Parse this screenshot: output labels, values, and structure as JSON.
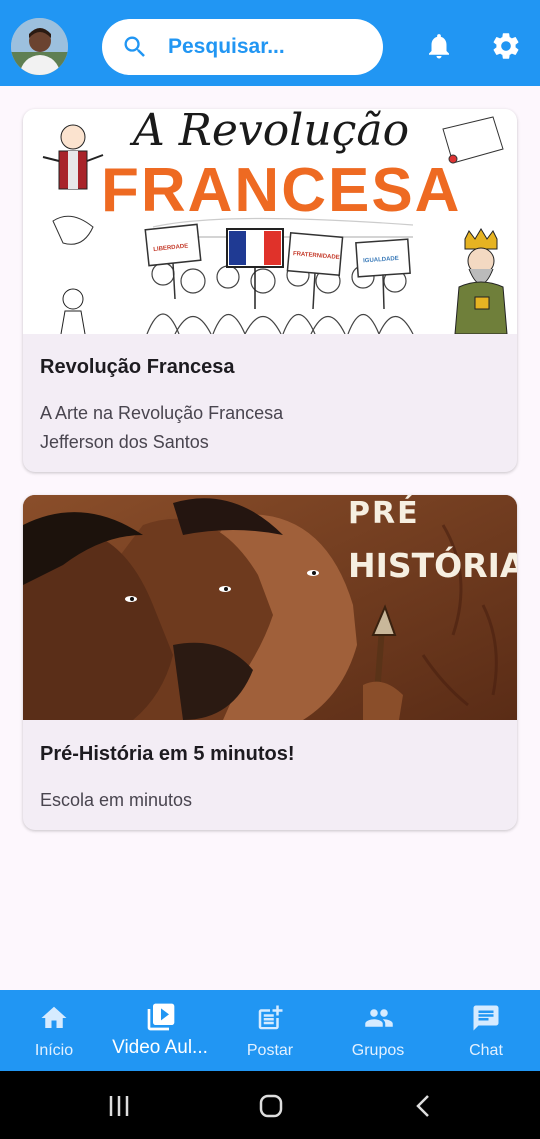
{
  "header": {
    "avatar_icon": "user-avatar",
    "search_placeholder": "Pesquisar...",
    "icons": [
      "search-icon",
      "bell-icon",
      "gear-icon"
    ]
  },
  "videos": [
    {
      "thumb_title_line1": "A Revolução",
      "thumb_title_line2": "FRANCESA",
      "banner_labels": [
        "LIBERDADE",
        "FRATERNIDADE",
        "IGUALDADE"
      ],
      "title": "Revolução Francesa",
      "subtitle_lines": [
        "A Arte na Revolução Francesa",
        "Jefferson dos Santos"
      ]
    },
    {
      "thumb_title_line1": "PRÉ",
      "thumb_title_line2": "HISTÓRIA",
      "title": "Pré-História em 5 minutos!",
      "subtitle_lines": [
        "Escola em minutos"
      ]
    }
  ],
  "nav": {
    "items": [
      {
        "label": "Início",
        "icon": "home-icon"
      },
      {
        "label": "Video Aul...",
        "icon": "video-library-icon",
        "active": true
      },
      {
        "label": "Postar",
        "icon": "post-add-icon"
      },
      {
        "label": "Grupos",
        "icon": "groups-icon"
      },
      {
        "label": "Chat",
        "icon": "chat-icon"
      }
    ]
  },
  "colors": {
    "primary": "#2196f3",
    "background": "#fdf7fd",
    "card": "#f3edf5",
    "accent_orange": "#ee6a22"
  }
}
